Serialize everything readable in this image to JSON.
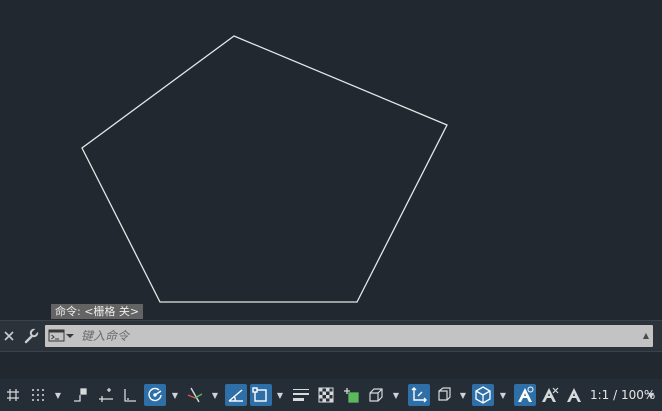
{
  "command_line": {
    "history": "命令: <栅格 关>",
    "input_placeholder": "键入命令",
    "close_icon": "close-icon",
    "settings_icon": "wrench-icon",
    "prompt_icon": "command-prompt-icon"
  },
  "drawing": {
    "shape": "pentagon",
    "stroke_color": "#e6e6e6"
  },
  "status_bar": {
    "annotation_scale": "1:1 / 100%",
    "active_color": "#2e6fa8"
  }
}
